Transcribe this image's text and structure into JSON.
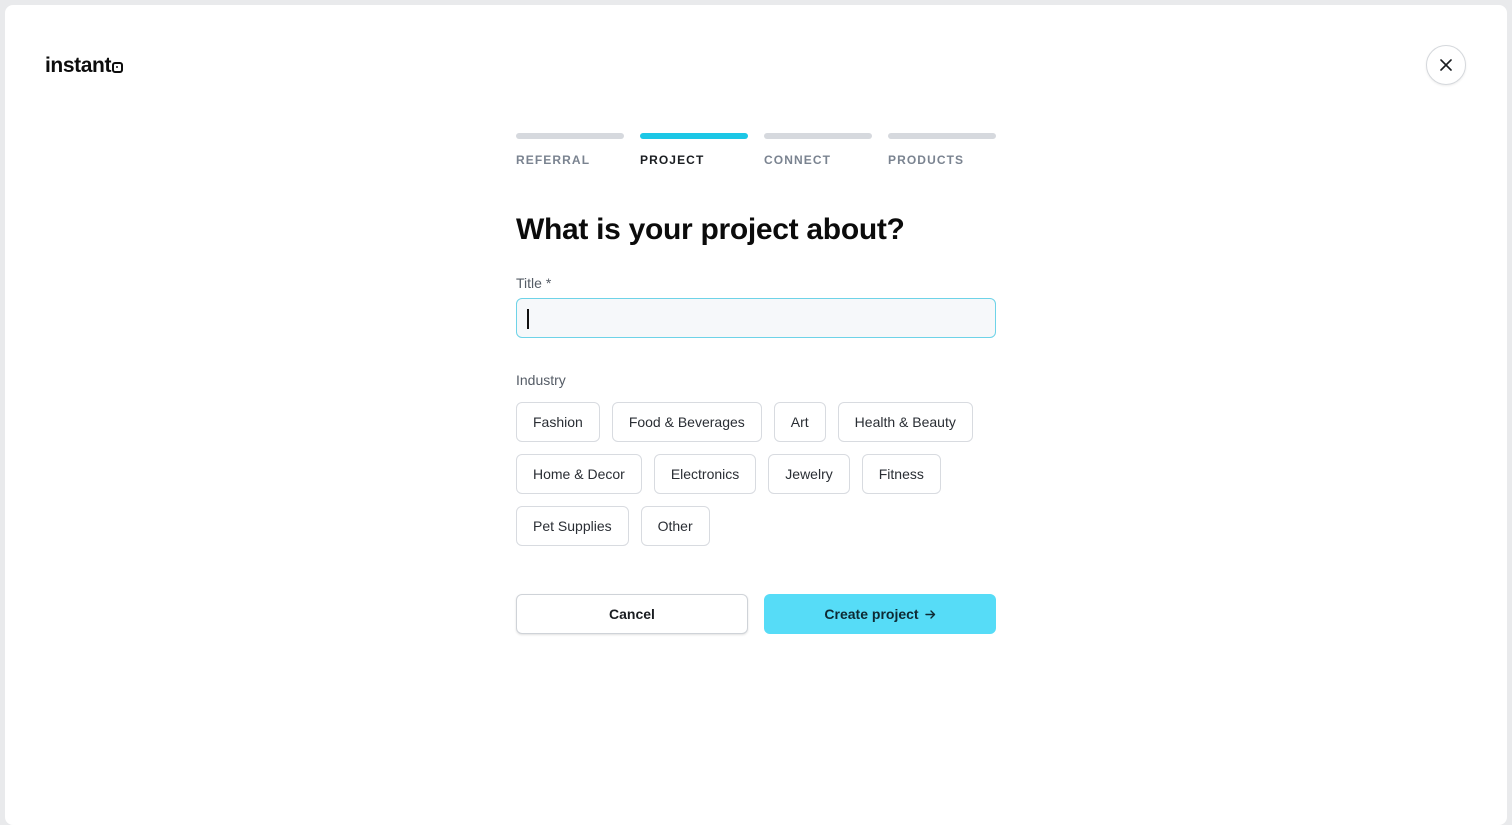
{
  "brand": {
    "name": "instant",
    "logo_icon": "square-dot-icon"
  },
  "header": {
    "close_icon": "close-icon"
  },
  "steps": [
    {
      "label": "REFERRAL",
      "active": false
    },
    {
      "label": "PROJECT",
      "active": true
    },
    {
      "label": "CONNECT",
      "active": false
    },
    {
      "label": "PRODUCTS",
      "active": false
    }
  ],
  "form": {
    "heading": "What is your project about?",
    "title_label": "Title *",
    "title_value": "",
    "industry_label": "Industry",
    "industries": [
      "Fashion",
      "Food & Beverages",
      "Art",
      "Health & Beauty",
      "Home & Decor",
      "Electronics",
      "Jewelry",
      "Fitness",
      "Pet Supplies",
      "Other"
    ]
  },
  "actions": {
    "cancel_label": "Cancel",
    "create_label": "Create project",
    "create_icon": "arrow-right-icon"
  },
  "colors": {
    "accent": "#1cc7e6",
    "primary_button": "#56dcf7",
    "input_focus_border": "#6ed3e8"
  }
}
